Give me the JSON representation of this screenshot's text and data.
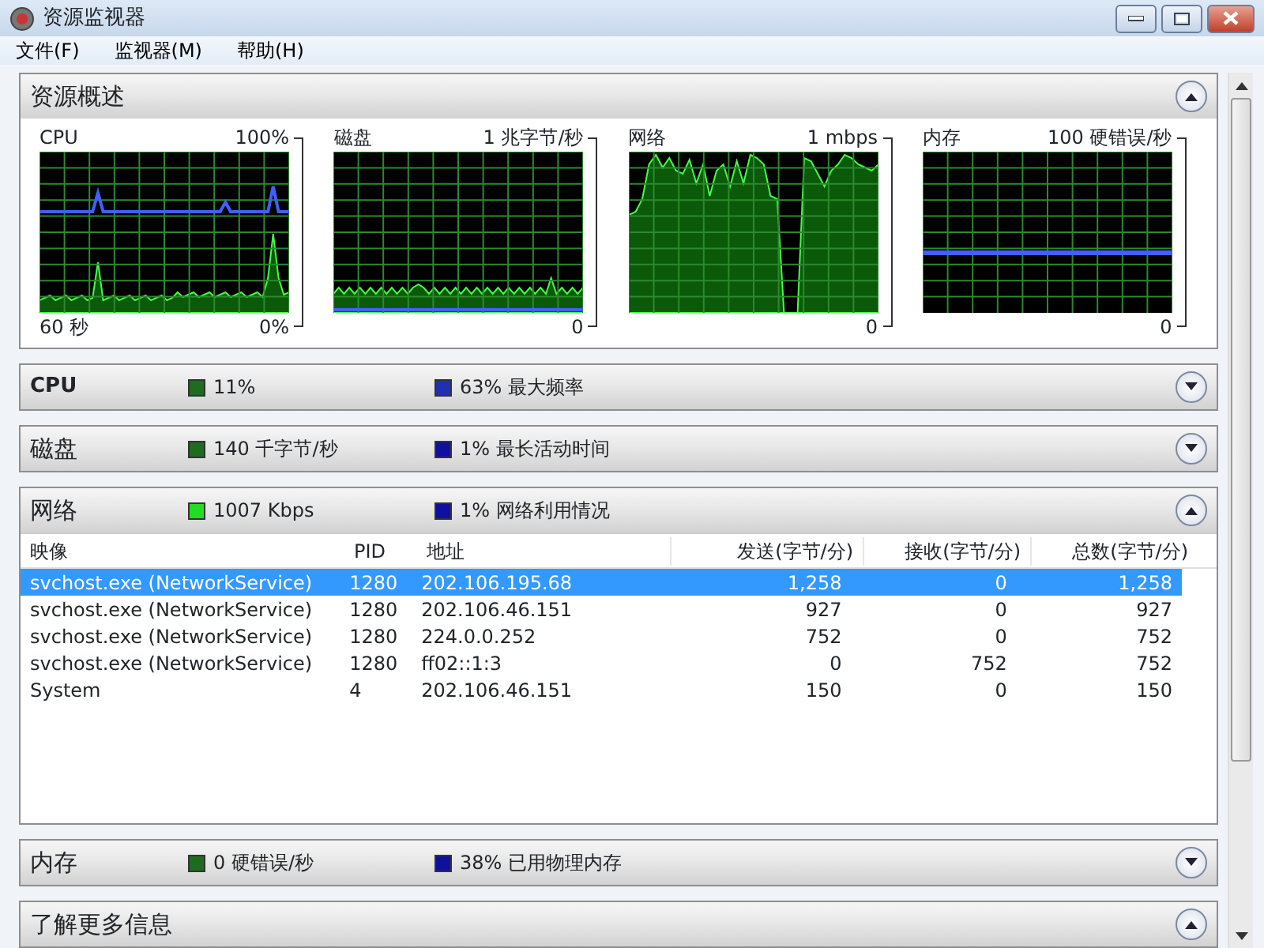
{
  "window": {
    "title": "资源监视器"
  },
  "menu": [
    "文件(F)",
    "监视器(M)",
    "帮助(H)"
  ],
  "overview": {
    "title": "资源概述",
    "expanded": true,
    "graphs": [
      {
        "name": "CPU",
        "max": "100%",
        "left_bottom": "60 秒",
        "min": "0%"
      },
      {
        "name": "磁盘",
        "max": "1 兆字节/秒",
        "min": "0"
      },
      {
        "name": "网络",
        "max": "1 mbps",
        "min": "0"
      },
      {
        "name": "内存",
        "max": "100 硬错误/秒",
        "min": "0"
      }
    ]
  },
  "sections": [
    {
      "title": "CPU",
      "expanded": false,
      "indicators": [
        {
          "color": "#1f6b1f",
          "text": "11%"
        },
        {
          "color": "#2030b0",
          "text": "63% 最大频率"
        }
      ]
    },
    {
      "title": "磁盘",
      "expanded": false,
      "indicators": [
        {
          "color": "#1f6b1f",
          "text": "140 千字节/秒"
        },
        {
          "color": "#1010a0",
          "text": "1% 最长活动时间"
        }
      ]
    },
    {
      "title": "网络",
      "expanded": true,
      "indicators": [
        {
          "color": "#22dd22",
          "text": "1007 Kbps"
        },
        {
          "color": "#1010a0",
          "text": "1% 网络利用情况"
        }
      ],
      "table": {
        "columns": [
          "映像",
          "PID",
          "地址",
          "发送(字节/分)",
          "接收(字节/分)",
          "总数(字节/分)"
        ],
        "rows": [
          {
            "selected": true,
            "cells": [
              "svchost.exe (NetworkService)",
              "1280",
              "202.106.195.68",
              "1,258",
              "0",
              "1,258"
            ]
          },
          {
            "selected": false,
            "cells": [
              "svchost.exe (NetworkService)",
              "1280",
              "202.106.46.151",
              "927",
              "0",
              "927"
            ]
          },
          {
            "selected": false,
            "cells": [
              "svchost.exe (NetworkService)",
              "1280",
              "224.0.0.252",
              "752",
              "0",
              "752"
            ]
          },
          {
            "selected": false,
            "cells": [
              "svchost.exe (NetworkService)",
              "1280",
              "ff02::1:3",
              "0",
              "752",
              "752"
            ]
          },
          {
            "selected": false,
            "cells": [
              "System",
              "4",
              "202.106.46.151",
              "150",
              "0",
              "150"
            ]
          }
        ]
      }
    },
    {
      "title": "内存",
      "expanded": false,
      "indicators": [
        {
          "color": "#1f6b1f",
          "text": "0 硬错误/秒"
        },
        {
          "color": "#1010a0",
          "text": "38% 已用物理内存"
        }
      ]
    },
    {
      "title": "了解更多信息",
      "expanded": true
    }
  ]
}
